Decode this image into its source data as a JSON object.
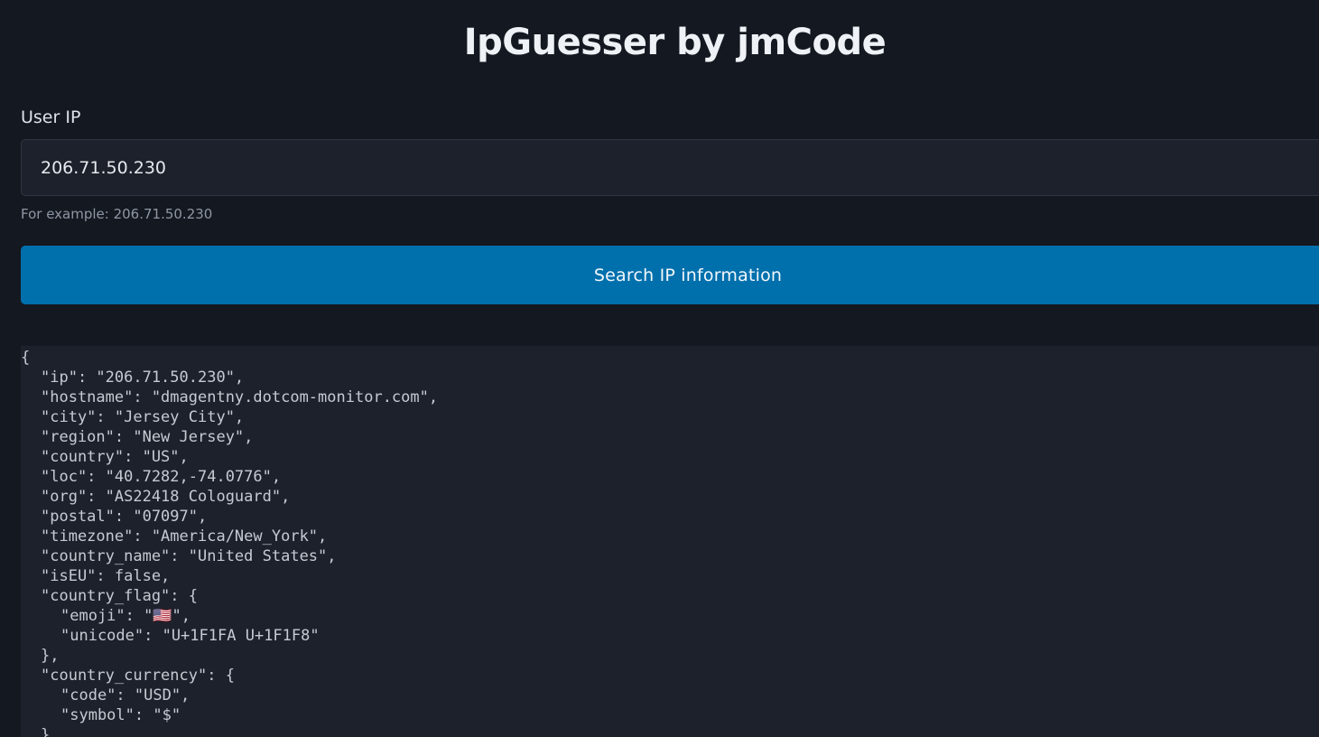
{
  "header": {
    "title": "IpGuesser by jmCode"
  },
  "form": {
    "label": "User IP",
    "input_value": "206.71.50.230",
    "helper_text": "For example: 206.71.50.230",
    "button_label": "Search IP information"
  },
  "result": {
    "lines": [
      "{",
      "\"ip\": \"206.71.50.230\",",
      "\"hostname\": \"dmagentny.dotcom-monitor.com\",",
      "\"city\": \"Jersey City\",",
      "\"region\": \"New Jersey\",",
      "\"country\": \"US\",",
      "\"loc\": \"40.7282,-74.0776\",",
      "\"org\": \"AS22418 Cologuard\",",
      "\"postal\": \"07097\",",
      "\"timezone\": \"America/New_York\",",
      "\"country_name\": \"United States\",",
      "\"isEU\": false,",
      "\"country_flag\": {",
      "\"emoji\": \"🇺🇸\",",
      "\"unicode\": \"U+1F1FA U+1F1F8\"",
      "},",
      "\"country_currency\": {",
      "\"code\": \"USD\",",
      "\"symbol\": \"$\"",
      "},"
    ]
  }
}
